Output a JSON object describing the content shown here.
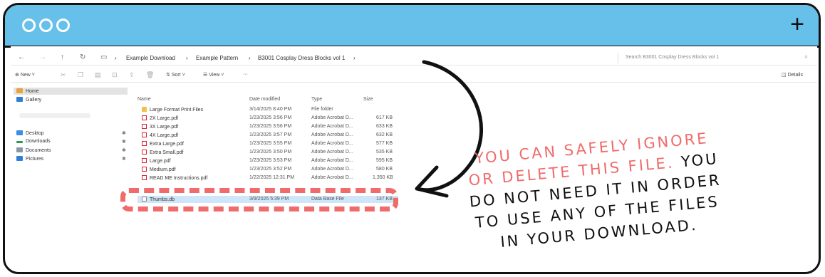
{
  "window": {
    "plus_icon": "plus-icon"
  },
  "address_bar": {
    "breadcrumbs": [
      "Example Download",
      "Example Pattern",
      "B3001 Cosplay Dress Blocks vol 1"
    ],
    "search_placeholder": "Search B3001 Cosplay Dress Blocks vol 1"
  },
  "toolbar": {
    "new": "New",
    "sort": "Sort",
    "view": "View",
    "more": "···",
    "details": "Details"
  },
  "sidebar": {
    "items": [
      "Home",
      "Gallery",
      "Desktop",
      "Downloads",
      "Documents",
      "Pictures"
    ]
  },
  "columns": [
    "Name",
    "Date modified",
    "Type",
    "Size"
  ],
  "files": [
    {
      "name": "Large Format Print Files",
      "date": "3/14/2025 8:40 PM",
      "type": "File folder",
      "size": ""
    },
    {
      "name": "2X Large.pdf",
      "date": "1/23/2025 3:56 PM",
      "type": "Adobe Acrobat D...",
      "size": "617 KB"
    },
    {
      "name": "3X Large.pdf",
      "date": "1/23/2025 3:56 PM",
      "type": "Adobe Acrobat D...",
      "size": "633 KB"
    },
    {
      "name": "4X Large.pdf",
      "date": "1/23/2025 3:57 PM",
      "type": "Adobe Acrobat D...",
      "size": "632 KB"
    },
    {
      "name": "Extra Large.pdf",
      "date": "1/23/2025 3:55 PM",
      "type": "Adobe Acrobat D...",
      "size": "577 KB"
    },
    {
      "name": "Extra Small.pdf",
      "date": "1/23/2025 3:50 PM",
      "type": "Adobe Acrobat D...",
      "size": "535 KB"
    },
    {
      "name": "Large.pdf",
      "date": "1/23/2025 3:53 PM",
      "type": "Adobe Acrobat D...",
      "size": "595 KB"
    },
    {
      "name": "Medium.pdf",
      "date": "1/23/2025 3:52 PM",
      "type": "Adobe Acrobat D...",
      "size": "580 KB"
    },
    {
      "name": "READ ME Instructions.pdf",
      "date": "1/22/2025 12:31 PM",
      "type": "Adobe Acrobat D...",
      "size": "1,350 KB"
    },
    {
      "name": "Thumbs.db",
      "date": "3/9/2025 5:39 PM",
      "type": "Data Base File",
      "size": "137 KB"
    }
  ],
  "callout": {
    "red_lines": [
      "YOU CAN SAFELY IGNORE",
      "OR DELETE THIS FILE."
    ],
    "black_lines": [
      "YOU",
      "DO NOT NEED IT IN ORDER",
      "TO USE ANY OF THE FILES",
      "IN YOUR DOWNLOAD."
    ]
  },
  "colors": {
    "titlebar": "#66c0ea",
    "highlight": "#f06b6b",
    "text": "#111111"
  }
}
